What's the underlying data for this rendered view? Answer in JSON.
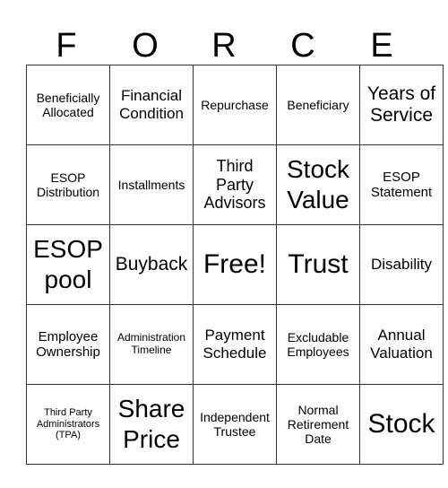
{
  "header_letters": [
    "F",
    "O",
    "R",
    "C",
    "E"
  ],
  "cells": [
    [
      "Beneficially Allocated",
      "Financial Condition",
      "Repurchase",
      "Beneficiary",
      "Years of Service"
    ],
    [
      "ESOP Distribution",
      "Installments",
      "Third Party Advisors",
      "Stock Value",
      "ESOP Statement"
    ],
    [
      "ESOP pool",
      "Buyback",
      "Free!",
      "Trust",
      "Disability"
    ],
    [
      "Employee Ownership",
      "Administration Timeline",
      "Payment Schedule",
      "Excludable Employees",
      "Annual Valuation"
    ],
    [
      "Third Party Administrators (TPA)",
      "Share Price",
      "Independent Trustee",
      "Normal Retirement Date",
      "Stock"
    ]
  ]
}
